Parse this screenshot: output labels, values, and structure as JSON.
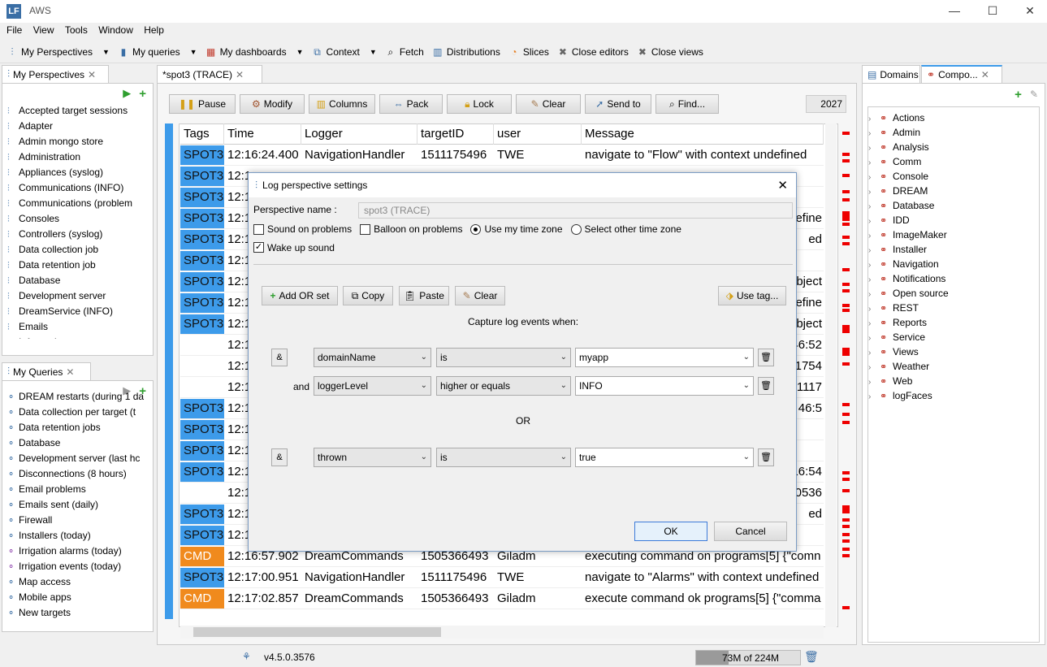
{
  "window": {
    "logo": "LF",
    "title": "AWS",
    "minimize": "—",
    "maximize": "☐",
    "close": "✕"
  },
  "menu": [
    "File",
    "View",
    "Tools",
    "Window",
    "Help"
  ],
  "toolbar": {
    "my_perspectives": "My Perspectives",
    "my_queries": "My queries",
    "my_dashboards": "My dashboards",
    "context": "Context",
    "fetch": "Fetch",
    "distributions": "Distributions",
    "slices": "Slices",
    "close_editors": "Close editors",
    "close_views": "Close views"
  },
  "perspectives": {
    "tab": "My Perspectives",
    "items": [
      "Accepted target sessions",
      "Adapter",
      "Admin mongo store",
      "Administration",
      "Appliances (syslog)",
      "Communications (INFO)",
      "Communications (problem",
      "Consoles",
      "Controllers (syslog)",
      "Data collection job",
      "Data retention job",
      "Database",
      "Development server",
      "DreamService (INFO)",
      "Emails",
      "Informative"
    ]
  },
  "queries": {
    "tab": "My Queries",
    "items": [
      "DREAM restarts (during 1 da",
      "Data collection per target (t",
      "Data retention jobs",
      "Database",
      "Development server (last hc",
      "Disconnections (8 hours)",
      "Email problems",
      "Emails sent (daily)",
      "Firewall",
      "Installers (today)",
      "Irrigation alarms (today)",
      "Irrigation events (today)",
      "Map access",
      "Mobile apps",
      "New targets"
    ]
  },
  "editor": {
    "tab": "*spot3 (TRACE)",
    "buttons": {
      "pause": "Pause",
      "modify": "Modify",
      "columns": "Columns",
      "pack": "Pack",
      "lock": "Lock",
      "clear": "Clear",
      "send_to": "Send to",
      "find": "Find..."
    },
    "count": "2027",
    "columns": [
      "Tags",
      "Time",
      "Logger",
      "targetID",
      "user",
      "Message"
    ],
    "rows": [
      {
        "tag": "SPOT3",
        "time": "12:16:24.400",
        "logger": "NavigationHandler",
        "target": "1511175496",
        "user": "TWE",
        "msg": "navigate to \"Flow\" with context undefined"
      },
      {
        "tag": "SPOT3",
        "time": "12:1",
        "logger": "",
        "target": "",
        "user": "",
        "msg": ""
      },
      {
        "tag": "SPOT3",
        "time": "12:1",
        "logger": "",
        "target": "",
        "user": "",
        "msg": ""
      },
      {
        "tag": "SPOT3",
        "time": "12:1",
        "logger": "",
        "target": "",
        "user": "",
        "msg": "efine"
      },
      {
        "tag": "SPOT3",
        "time": "12:1",
        "logger": "",
        "target": "",
        "user": "",
        "msg": "ed"
      },
      {
        "tag": "SPOT3",
        "time": "12:1",
        "logger": "",
        "target": "",
        "user": "",
        "msg": ""
      },
      {
        "tag": "SPOT3",
        "time": "12:1",
        "logger": "",
        "target": "",
        "user": "",
        "msg": "bject"
      },
      {
        "tag": "SPOT3",
        "time": "12:1",
        "logger": "",
        "target": "",
        "user": "",
        "msg": "efine"
      },
      {
        "tag": "SPOT3",
        "time": "12:1",
        "logger": "",
        "target": "",
        "user": "",
        "msg": "bject"
      },
      {
        "tag": "",
        "time": "12:1",
        "logger": "",
        "target": "",
        "user": "",
        "msg": "46:52"
      },
      {
        "tag": "",
        "time": "12:1",
        "logger": "",
        "target": "",
        "user": "",
        "msg": "1754"
      },
      {
        "tag": "",
        "time": "12:1",
        "logger": "",
        "target": "",
        "user": "",
        "msg": "1117"
      },
      {
        "tag": "SPOT3",
        "time": "12:1",
        "logger": "",
        "target": "",
        "user": "",
        "msg": "46:5"
      },
      {
        "tag": "SPOT3",
        "time": "12:1",
        "logger": "",
        "target": "",
        "user": "",
        "msg": ""
      },
      {
        "tag": "SPOT3",
        "time": "12:1",
        "logger": "",
        "target": "",
        "user": "",
        "msg": ""
      },
      {
        "tag": "SPOT3",
        "time": "12:1",
        "logger": "",
        "target": "",
        "user": "",
        "msg": "16:54"
      },
      {
        "tag": "",
        "time": "12:1",
        "logger": "",
        "target": "",
        "user": "",
        "msg": "0536"
      },
      {
        "tag": "SPOT3",
        "time": "12:1",
        "logger": "",
        "target": "",
        "user": "",
        "msg": "ed"
      },
      {
        "tag": "SPOT3",
        "time": "12:1",
        "logger": "",
        "target": "",
        "user": "",
        "msg": ""
      },
      {
        "tag": "CMD",
        "time": "12:16:57.902",
        "logger": "DreamCommands",
        "target": "1505366493",
        "user": "Giladm",
        "msg": "executing command on programs[5] {\"comn"
      },
      {
        "tag": "SPOT3",
        "time": "12:17:00.951",
        "logger": "NavigationHandler",
        "target": "1511175496",
        "user": "TWE",
        "msg": "navigate to \"Alarms\" with context undefined"
      },
      {
        "tag": "CMD",
        "time": "12:17:02.857",
        "logger": "DreamCommands",
        "target": "1505366493",
        "user": "Giladm",
        "msg": "execute command ok programs[5] {\"comma"
      }
    ]
  },
  "dialog": {
    "title": "Log perspective settings",
    "name_label": "Perspective name :",
    "name_value": "spot3 (TRACE)",
    "sound": "Sound on problems",
    "balloon": "Balloon on problems",
    "my_tz": "Use my time zone",
    "other_tz": "Select other time zone",
    "wakeup": "Wake up sound",
    "add_or": "Add OR set",
    "copy": "Copy",
    "paste": "Paste",
    "clear": "Clear",
    "use_tag": "Use tag...",
    "capture": "Capture log events when:",
    "amp": "&",
    "and": "and",
    "or": "OR",
    "cond1": {
      "field": "domainName",
      "op": "is",
      "value": "myapp"
    },
    "cond2": {
      "field": "loggerLevel",
      "op": "higher or equals",
      "value": "INFO"
    },
    "cond3": {
      "field": "thrown",
      "op": "is",
      "value": "true"
    },
    "ok": "OK",
    "cancel": "Cancel"
  },
  "right": {
    "tab1": "Domains",
    "tab2": "Compo...",
    "items": [
      "Actions",
      "Admin",
      "Analysis",
      "Comm",
      "Console",
      "DREAM",
      "Database",
      "IDD",
      "ImageMaker",
      "Installer",
      "Navigation",
      "Notifications",
      "Open source",
      "REST",
      "Reports",
      "Service",
      "Views",
      "Weather",
      "Web",
      "logFaces"
    ]
  },
  "status": {
    "version": "v4.5.0.3576",
    "memory": "73M of 224M"
  }
}
